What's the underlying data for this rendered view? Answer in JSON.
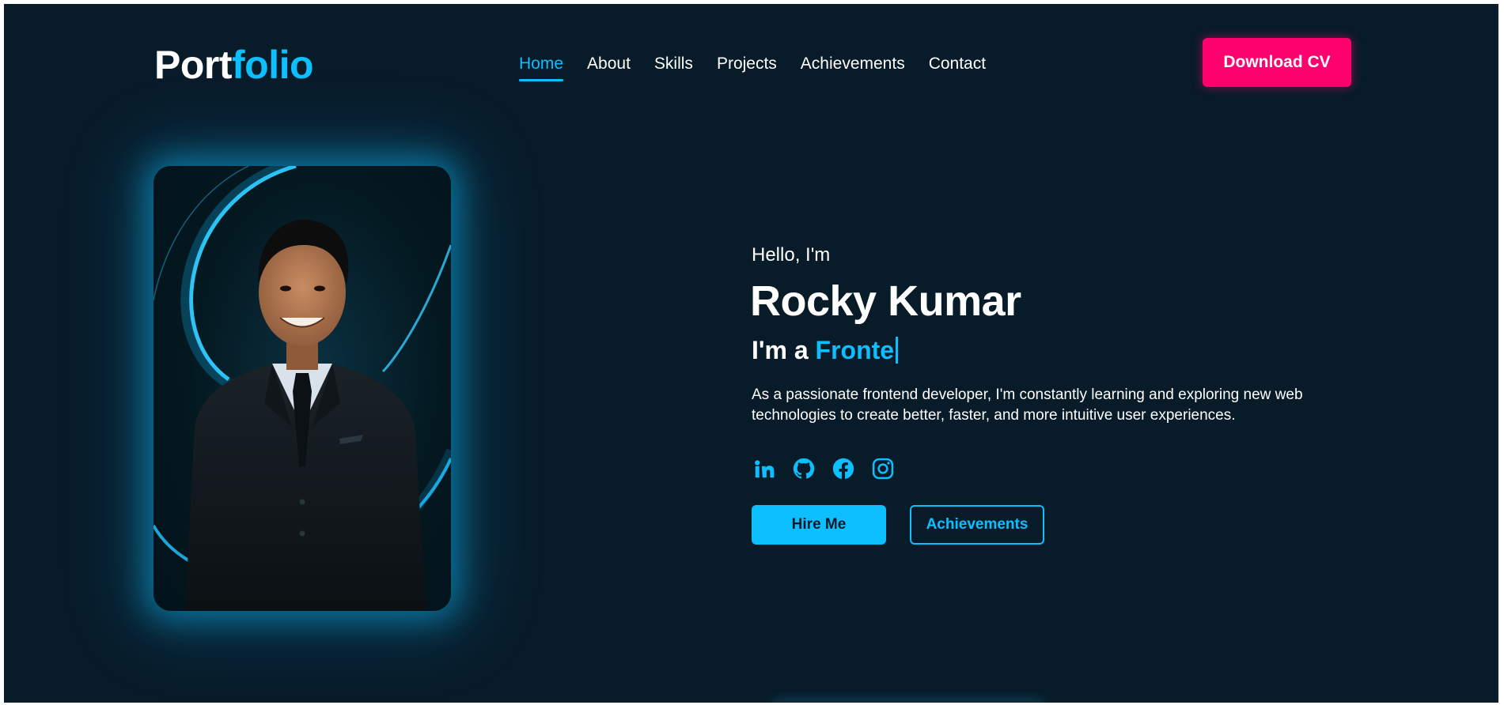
{
  "header": {
    "logo_part1": "Port",
    "logo_part2": "folio",
    "nav": [
      "Home",
      "About",
      "Skills",
      "Projects",
      "Achievements",
      "Contact"
    ],
    "active_nav": "Home",
    "cta_label": "Download CV"
  },
  "hero": {
    "greeting": "Hello, I'm",
    "name": "Rocky Kumar",
    "role_prefix": "I'm a ",
    "role_typed": "Fronte",
    "description": "As a passionate frontend developer, I'm constantly learning and exploring new web technologies to create better, faster, and more intuitive user experiences.",
    "socials": [
      "linkedin-icon",
      "github-icon",
      "facebook-icon",
      "instagram-icon"
    ],
    "primary_button": "Hire Me",
    "secondary_button": "Achievements"
  },
  "colors": {
    "background": "#081b29",
    "accent": "#0ebfff",
    "cta": "#ff006e",
    "text": "#ffffff"
  }
}
